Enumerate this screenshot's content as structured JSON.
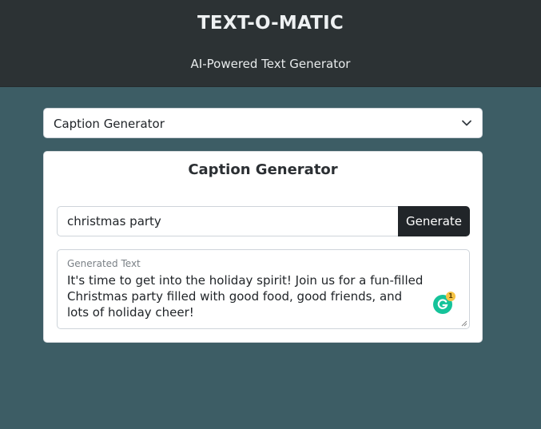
{
  "header": {
    "title": "TEXT-O-MATIC",
    "subtitle": "AI-Powered Text Generator"
  },
  "generator_select": {
    "selected": "Caption Generator",
    "icon": "chevron-down-icon"
  },
  "card": {
    "title": "Caption Generator",
    "prompt_value": "christmas party",
    "generate_label": "Generate",
    "output_label": "Generated Text",
    "output_text": "It's time to get into the holiday spirit! Join us for a fun-filled Christmas party filled with good food, good friends, and lots of holiday cheer!",
    "grammarly_count": "1"
  },
  "colors": {
    "background": "#3d5d65",
    "header": "#2c3234",
    "button": "#212529",
    "grammarly": "#15c39a"
  }
}
